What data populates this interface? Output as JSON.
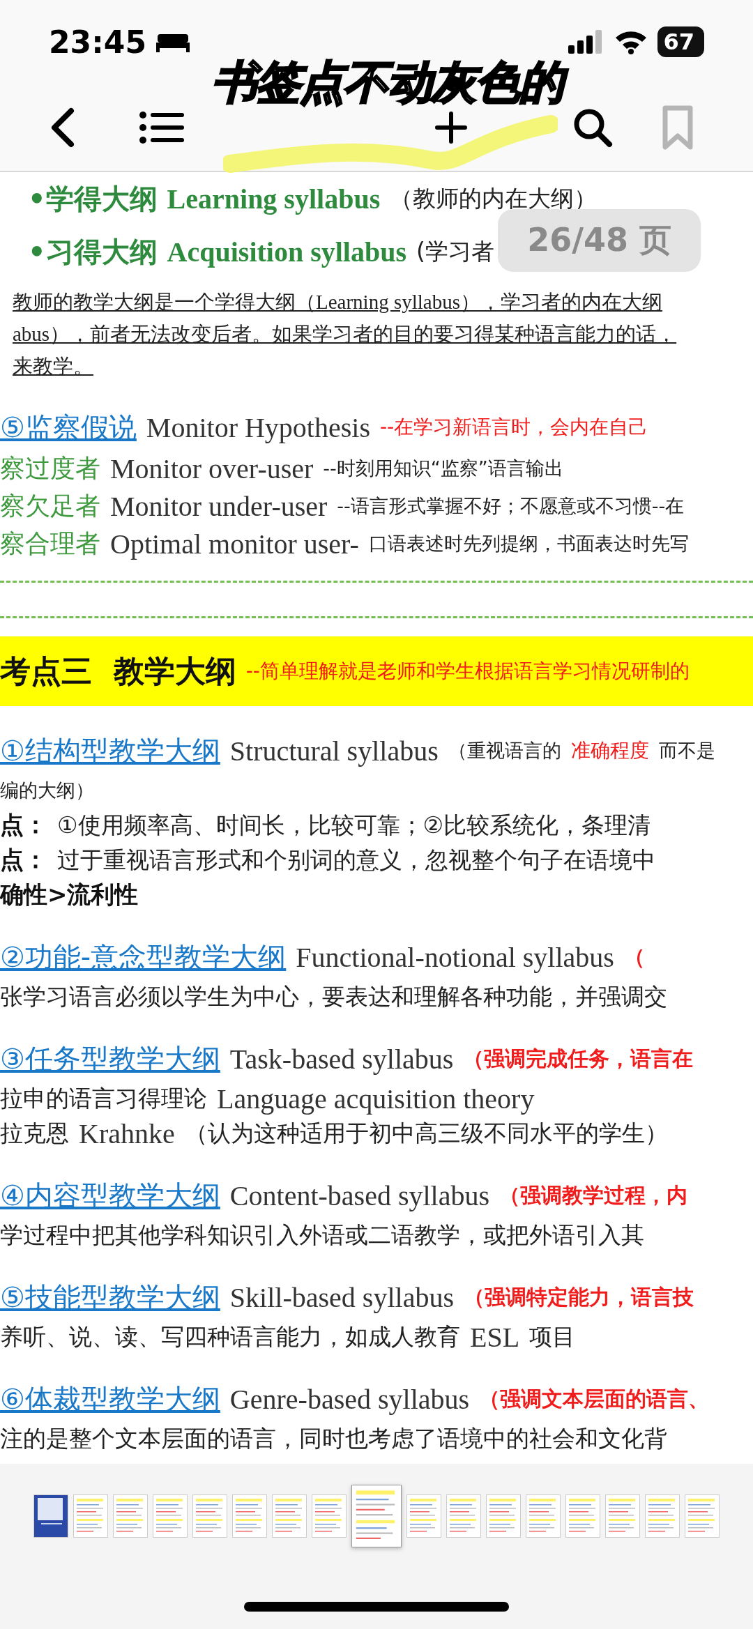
{
  "status_bar": {
    "time": "23:45",
    "battery": "67"
  },
  "caption": "书签点不动灰色的",
  "toolbar": {
    "bookmark": {
      "disabled": true
    }
  },
  "page_indicator": "26/48 页",
  "document": {
    "lines": [
      {
        "kind": "bullet",
        "segments": [
          {
            "kind": "term",
            "text": "•学得大纲"
          },
          {
            "kind": "term_en",
            "text": "Learning syllabus"
          },
          {
            "kind": "plain",
            "text": "（教师的内在大纲）"
          }
        ]
      },
      {
        "kind": "bullet",
        "segments": [
          {
            "kind": "term",
            "text": "•习得大纲"
          },
          {
            "kind": "term_en",
            "text": "Acquisition syllabus"
          },
          {
            "kind": "plain",
            "text": "(学习者"
          }
        ]
      },
      {
        "kind": "para",
        "segments": [
          {
            "kind": "para",
            "text": "教师的教学大纲是一个学得大纲（Learning syllabus），学习者的内在大纲"
          }
        ]
      },
      {
        "kind": "para",
        "segments": [
          {
            "kind": "para",
            "text": "abus），前者无法改变后者。如果学习者的目的要习得某种语言能力的话，"
          }
        ]
      },
      {
        "kind": "para",
        "segments": [
          {
            "kind": "para",
            "text": "来教学。"
          }
        ]
      },
      {
        "kind": "heading",
        "segments": [
          {
            "kind": "heading",
            "text": "⑤监察假说"
          },
          {
            "kind": "english",
            "text": "Monitor Hypothesis"
          },
          {
            "kind": "note",
            "text": "--在学习新语言时，会内在自己"
          }
        ]
      },
      {
        "kind": "sub",
        "segments": [
          {
            "kind": "sub_term",
            "text": "察过度者"
          },
          {
            "kind": "english",
            "text": "Monitor over-user"
          },
          {
            "kind": "small",
            "text": "--时刻用知识“监察”语言输出"
          }
        ]
      },
      {
        "kind": "sub",
        "segments": [
          {
            "kind": "sub_term",
            "text": "察欠足者"
          },
          {
            "kind": "english",
            "text": "Monitor under-user"
          },
          {
            "kind": "small",
            "text": "--语言形式掌握不好；不愿意或不习惯--在"
          }
        ]
      },
      {
        "kind": "sub",
        "segments": [
          {
            "kind": "sub_term",
            "text": "察合理者"
          },
          {
            "kind": "english",
            "text": "Optimal monitor user-"
          },
          {
            "kind": "small",
            "text": "口语表述时先列提纲，书面表达时先写"
          }
        ]
      },
      {
        "kind": "band",
        "segments": [
          {
            "kind": "band_title",
            "text": "考点三  教学大纲"
          },
          {
            "kind": "note",
            "text": "--简单理解就是老师和学生根据语言学习情况研制的"
          }
        ]
      },
      {
        "kind": "heading",
        "segments": [
          {
            "kind": "heading",
            "text": "①结构型教学大纲"
          },
          {
            "kind": "english",
            "text": "Structural syllabus"
          },
          {
            "kind": "small",
            "text": "（重视语言的"
          },
          {
            "kind": "note",
            "text": "准确程度"
          },
          {
            "kind": "small",
            "text": "而不是"
          }
        ]
      },
      {
        "kind": "body",
        "segments": [
          {
            "kind": "small",
            "text": "编的大纲）"
          }
        ]
      },
      {
        "kind": "body",
        "segments": [
          {
            "kind": "label",
            "text": "点："
          },
          {
            "kind": "plain",
            "text": "①使用频率高、时间长，比较可靠；②比较系统化，条理清"
          }
        ]
      },
      {
        "kind": "body",
        "segments": [
          {
            "kind": "label",
            "text": "点："
          },
          {
            "kind": "plain",
            "text": "过于重视语言形式和个别词的意义，忽视整个句子在语境中"
          }
        ]
      },
      {
        "kind": "body",
        "segments": [
          {
            "kind": "label",
            "text": "确性>流利性"
          }
        ]
      },
      {
        "kind": "heading",
        "segments": [
          {
            "kind": "heading",
            "text": "②功能-意念型教学大纲"
          },
          {
            "kind": "english",
            "text": "Functional-notional syllabus"
          },
          {
            "kind": "note_bold",
            "text": "（"
          }
        ]
      },
      {
        "kind": "body",
        "segments": [
          {
            "kind": "plain",
            "text": "张学习语言必须以学生为中心，要表达和理解各种功能，并强调交"
          }
        ]
      },
      {
        "kind": "heading",
        "segments": [
          {
            "kind": "heading",
            "text": "③任务型教学大纲"
          },
          {
            "kind": "english",
            "text": "Task-based syllabus"
          },
          {
            "kind": "note_bold",
            "text": "（强调完成任务，语言在"
          }
        ]
      },
      {
        "kind": "body",
        "segments": [
          {
            "kind": "plain",
            "text": "拉申的语言习得理论"
          },
          {
            "kind": "english",
            "text": "Language acquisition theory"
          }
        ]
      },
      {
        "kind": "body",
        "segments": [
          {
            "kind": "plain",
            "text": "拉克恩"
          },
          {
            "kind": "english",
            "text": "Krahnke"
          },
          {
            "kind": "plain",
            "text": "（认为这种适用于初中高三级不同水平的学生）"
          }
        ]
      },
      {
        "kind": "heading",
        "segments": [
          {
            "kind": "heading",
            "text": "④内容型教学大纲"
          },
          {
            "kind": "english",
            "text": "Content-based syllabus"
          },
          {
            "kind": "note_bold",
            "text": "（强调教学过程，内"
          }
        ]
      },
      {
        "kind": "body",
        "segments": [
          {
            "kind": "plain",
            "text": "学过程中把其他学科知识引入外语或二语教学，或把外语引入其"
          }
        ]
      },
      {
        "kind": "heading",
        "segments": [
          {
            "kind": "heading",
            "text": "⑤技能型教学大纲"
          },
          {
            "kind": "english",
            "text": "Skill-based syllabus"
          },
          {
            "kind": "note_bold",
            "text": "（强调特定能力，语言技"
          }
        ]
      },
      {
        "kind": "body",
        "segments": [
          {
            "kind": "plain",
            "text": "养听、说、读、写四种语言能力，如成人教育"
          },
          {
            "kind": "english",
            "text": "ESL"
          },
          {
            "kind": "plain",
            "text": "项目"
          }
        ]
      },
      {
        "kind": "heading",
        "segments": [
          {
            "kind": "heading",
            "text": "⑥体裁型教学大纲"
          },
          {
            "kind": "english",
            "text": "Genre-based syllabus"
          },
          {
            "kind": "note_bold",
            "text": "（强调文本层面的语言、"
          }
        ]
      },
      {
        "kind": "body",
        "segments": [
          {
            "kind": "plain",
            "text": "注的是整个文本层面的语言，同时也考虑了语境中的社会和文化背"
          }
        ]
      }
    ]
  },
  "thumbnails": [
    {
      "kind": "cover",
      "selected": false
    },
    {
      "kind": "page",
      "selected": false
    },
    {
      "kind": "page",
      "selected": false
    },
    {
      "kind": "page",
      "selected": false
    },
    {
      "kind": "page",
      "selected": false
    },
    {
      "kind": "page",
      "selected": false
    },
    {
      "kind": "page",
      "selected": false
    },
    {
      "kind": "page",
      "selected": false
    },
    {
      "kind": "page",
      "selected": true
    },
    {
      "kind": "page",
      "selected": false
    },
    {
      "kind": "page",
      "selected": false
    },
    {
      "kind": "page",
      "selected": false
    },
    {
      "kind": "page",
      "selected": false
    },
    {
      "kind": "page",
      "selected": false
    },
    {
      "kind": "page",
      "selected": false
    },
    {
      "kind": "page",
      "selected": false
    },
    {
      "kind": "page",
      "selected": false
    }
  ]
}
